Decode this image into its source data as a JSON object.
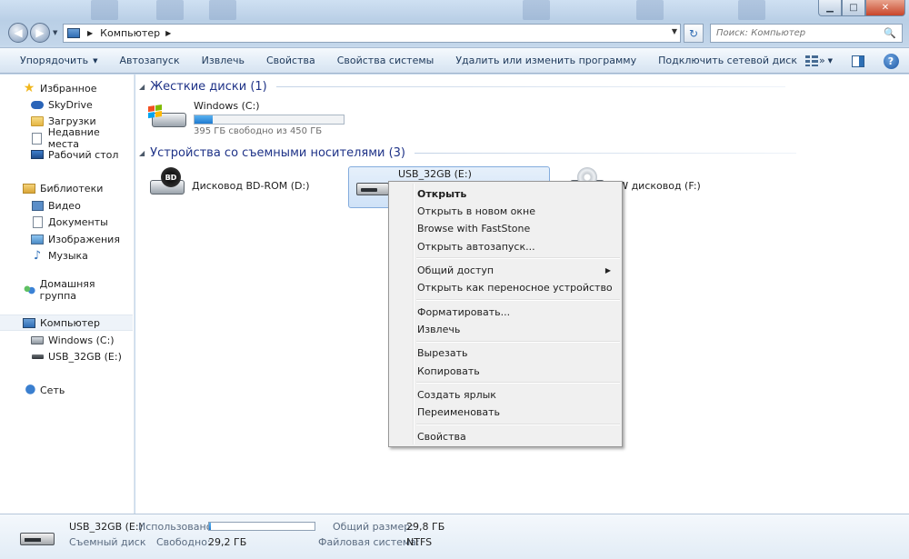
{
  "window": {
    "controls": {
      "minimize": "▁",
      "maximize": "□",
      "close": "✕"
    }
  },
  "nav": {
    "back_glyph": "◀",
    "forward_glyph": "▶",
    "dropdown_glyph": "▼"
  },
  "address": {
    "separator": "▶",
    "crumb": "Компьютер",
    "crumb_arrow": "▶",
    "dropdown": "▼",
    "refresh_glyph": "↻"
  },
  "search": {
    "placeholder": "Поиск: Компьютер",
    "icon": "🔍"
  },
  "toolbar": {
    "organize": "Упорядочить",
    "organize_arrow": "▼",
    "autoplay": "Автозапуск",
    "eject": "Извлечь",
    "properties": "Свойства",
    "system_properties": "Свойства системы",
    "uninstall": "Удалить или изменить программу",
    "map_drive": "Подключить сетевой диск",
    "more": "»",
    "views_arrow": "▼",
    "help": "?"
  },
  "sidebar": {
    "favorites": "Избранное",
    "skydrive": "SkyDrive",
    "downloads": "Загрузки",
    "recent": "Недавние места",
    "desktop": "Рабочий стол",
    "libraries": "Библиотеки",
    "video": "Видео",
    "documents": "Документы",
    "pictures": "Изображения",
    "music": "Музыка",
    "homegroup": "Домашняя группа",
    "computer": "Компьютер",
    "drive_c": "Windows (C:)",
    "drive_e": "USB_32GB (E:)",
    "network": "Сеть",
    "star_glyph": "★",
    "music_glyph": "♪"
  },
  "content": {
    "hdd_group": "Жесткие диски (1)",
    "removable_group": "Устройства со съемными носителями (3)",
    "group_arrow": "◢",
    "drives": {
      "c_name": "Windows (C:)",
      "c_free": "395 ГБ свободно из 450 ГБ",
      "c_used_fraction": 0.122,
      "d_name": "Дисковод BD-ROM (D:)",
      "d_badge": "BD",
      "e_name": "USB_32GB (E:)",
      "f_name_visible": "RW дисковод (F:)"
    }
  },
  "context_menu": {
    "open": "Открыть",
    "open_new_window": "Открыть в новом окне",
    "faststone": "Browse with FastStone",
    "open_autoplay": "Открыть автозапуск...",
    "share": "Общий доступ",
    "share_arrow": "▶",
    "open_portable": "Открыть как переносное устройство",
    "format": "Форматировать...",
    "eject": "Извлечь",
    "cut": "Вырезать",
    "copy": "Копировать",
    "create_shortcut": "Создать ярлык",
    "rename": "Переименовать",
    "properties": "Свойства"
  },
  "details": {
    "name": "USB_32GB (E:)",
    "type": "Съемный диск",
    "used_label": "Использовано:",
    "used_fraction": 0.02,
    "free_label": "Свободно:",
    "free_value": "29,2 ГБ",
    "total_label": "Общий размер:",
    "total_value": "29,8 ГБ",
    "fs_label": "Файловая система:",
    "fs_value": "NTFS"
  }
}
